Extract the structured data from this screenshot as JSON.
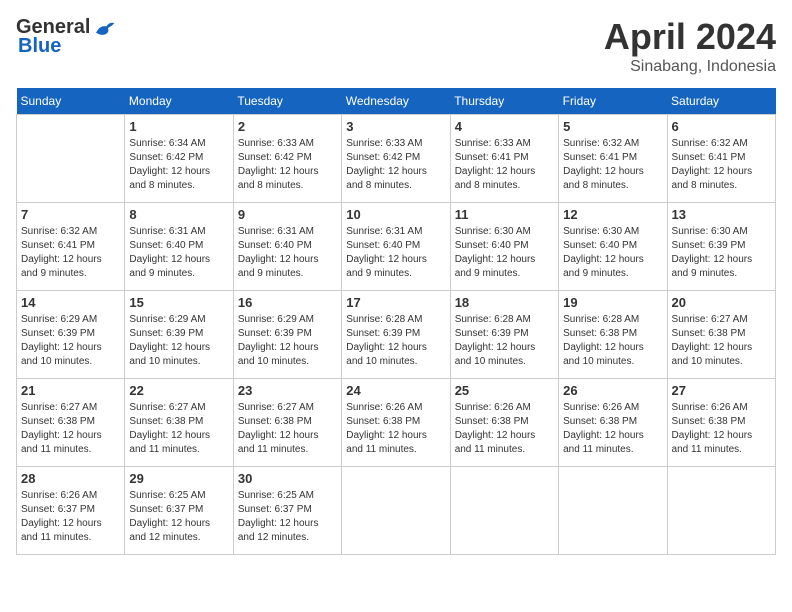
{
  "logo": {
    "general": "General",
    "blue": "Blue"
  },
  "title": {
    "month": "April 2024",
    "location": "Sinabang, Indonesia"
  },
  "header_days": [
    "Sunday",
    "Monday",
    "Tuesday",
    "Wednesday",
    "Thursday",
    "Friday",
    "Saturday"
  ],
  "weeks": [
    [
      {
        "day": "",
        "sunrise": "",
        "sunset": "",
        "daylight": ""
      },
      {
        "day": "1",
        "sunrise": "Sunrise: 6:34 AM",
        "sunset": "Sunset: 6:42 PM",
        "daylight": "Daylight: 12 hours and 8 minutes."
      },
      {
        "day": "2",
        "sunrise": "Sunrise: 6:33 AM",
        "sunset": "Sunset: 6:42 PM",
        "daylight": "Daylight: 12 hours and 8 minutes."
      },
      {
        "day": "3",
        "sunrise": "Sunrise: 6:33 AM",
        "sunset": "Sunset: 6:42 PM",
        "daylight": "Daylight: 12 hours and 8 minutes."
      },
      {
        "day": "4",
        "sunrise": "Sunrise: 6:33 AM",
        "sunset": "Sunset: 6:41 PM",
        "daylight": "Daylight: 12 hours and 8 minutes."
      },
      {
        "day": "5",
        "sunrise": "Sunrise: 6:32 AM",
        "sunset": "Sunset: 6:41 PM",
        "daylight": "Daylight: 12 hours and 8 minutes."
      },
      {
        "day": "6",
        "sunrise": "Sunrise: 6:32 AM",
        "sunset": "Sunset: 6:41 PM",
        "daylight": "Daylight: 12 hours and 8 minutes."
      }
    ],
    [
      {
        "day": "7",
        "sunrise": "Sunrise: 6:32 AM",
        "sunset": "Sunset: 6:41 PM",
        "daylight": "Daylight: 12 hours and 9 minutes."
      },
      {
        "day": "8",
        "sunrise": "Sunrise: 6:31 AM",
        "sunset": "Sunset: 6:40 PM",
        "daylight": "Daylight: 12 hours and 9 minutes."
      },
      {
        "day": "9",
        "sunrise": "Sunrise: 6:31 AM",
        "sunset": "Sunset: 6:40 PM",
        "daylight": "Daylight: 12 hours and 9 minutes."
      },
      {
        "day": "10",
        "sunrise": "Sunrise: 6:31 AM",
        "sunset": "Sunset: 6:40 PM",
        "daylight": "Daylight: 12 hours and 9 minutes."
      },
      {
        "day": "11",
        "sunrise": "Sunrise: 6:30 AM",
        "sunset": "Sunset: 6:40 PM",
        "daylight": "Daylight: 12 hours and 9 minutes."
      },
      {
        "day": "12",
        "sunrise": "Sunrise: 6:30 AM",
        "sunset": "Sunset: 6:40 PM",
        "daylight": "Daylight: 12 hours and 9 minutes."
      },
      {
        "day": "13",
        "sunrise": "Sunrise: 6:30 AM",
        "sunset": "Sunset: 6:39 PM",
        "daylight": "Daylight: 12 hours and 9 minutes."
      }
    ],
    [
      {
        "day": "14",
        "sunrise": "Sunrise: 6:29 AM",
        "sunset": "Sunset: 6:39 PM",
        "daylight": "Daylight: 12 hours and 10 minutes."
      },
      {
        "day": "15",
        "sunrise": "Sunrise: 6:29 AM",
        "sunset": "Sunset: 6:39 PM",
        "daylight": "Daylight: 12 hours and 10 minutes."
      },
      {
        "day": "16",
        "sunrise": "Sunrise: 6:29 AM",
        "sunset": "Sunset: 6:39 PM",
        "daylight": "Daylight: 12 hours and 10 minutes."
      },
      {
        "day": "17",
        "sunrise": "Sunrise: 6:28 AM",
        "sunset": "Sunset: 6:39 PM",
        "daylight": "Daylight: 12 hours and 10 minutes."
      },
      {
        "day": "18",
        "sunrise": "Sunrise: 6:28 AM",
        "sunset": "Sunset: 6:39 PM",
        "daylight": "Daylight: 12 hours and 10 minutes."
      },
      {
        "day": "19",
        "sunrise": "Sunrise: 6:28 AM",
        "sunset": "Sunset: 6:38 PM",
        "daylight": "Daylight: 12 hours and 10 minutes."
      },
      {
        "day": "20",
        "sunrise": "Sunrise: 6:27 AM",
        "sunset": "Sunset: 6:38 PM",
        "daylight": "Daylight: 12 hours and 10 minutes."
      }
    ],
    [
      {
        "day": "21",
        "sunrise": "Sunrise: 6:27 AM",
        "sunset": "Sunset: 6:38 PM",
        "daylight": "Daylight: 12 hours and 11 minutes."
      },
      {
        "day": "22",
        "sunrise": "Sunrise: 6:27 AM",
        "sunset": "Sunset: 6:38 PM",
        "daylight": "Daylight: 12 hours and 11 minutes."
      },
      {
        "day": "23",
        "sunrise": "Sunrise: 6:27 AM",
        "sunset": "Sunset: 6:38 PM",
        "daylight": "Daylight: 12 hours and 11 minutes."
      },
      {
        "day": "24",
        "sunrise": "Sunrise: 6:26 AM",
        "sunset": "Sunset: 6:38 PM",
        "daylight": "Daylight: 12 hours and 11 minutes."
      },
      {
        "day": "25",
        "sunrise": "Sunrise: 6:26 AM",
        "sunset": "Sunset: 6:38 PM",
        "daylight": "Daylight: 12 hours and 11 minutes."
      },
      {
        "day": "26",
        "sunrise": "Sunrise: 6:26 AM",
        "sunset": "Sunset: 6:38 PM",
        "daylight": "Daylight: 12 hours and 11 minutes."
      },
      {
        "day": "27",
        "sunrise": "Sunrise: 6:26 AM",
        "sunset": "Sunset: 6:38 PM",
        "daylight": "Daylight: 12 hours and 11 minutes."
      }
    ],
    [
      {
        "day": "28",
        "sunrise": "Sunrise: 6:26 AM",
        "sunset": "Sunset: 6:37 PM",
        "daylight": "Daylight: 12 hours and 11 minutes."
      },
      {
        "day": "29",
        "sunrise": "Sunrise: 6:25 AM",
        "sunset": "Sunset: 6:37 PM",
        "daylight": "Daylight: 12 hours and 12 minutes."
      },
      {
        "day": "30",
        "sunrise": "Sunrise: 6:25 AM",
        "sunset": "Sunset: 6:37 PM",
        "daylight": "Daylight: 12 hours and 12 minutes."
      },
      {
        "day": "",
        "sunrise": "",
        "sunset": "",
        "daylight": ""
      },
      {
        "day": "",
        "sunrise": "",
        "sunset": "",
        "daylight": ""
      },
      {
        "day": "",
        "sunrise": "",
        "sunset": "",
        "daylight": ""
      },
      {
        "day": "",
        "sunrise": "",
        "sunset": "",
        "daylight": ""
      }
    ]
  ]
}
